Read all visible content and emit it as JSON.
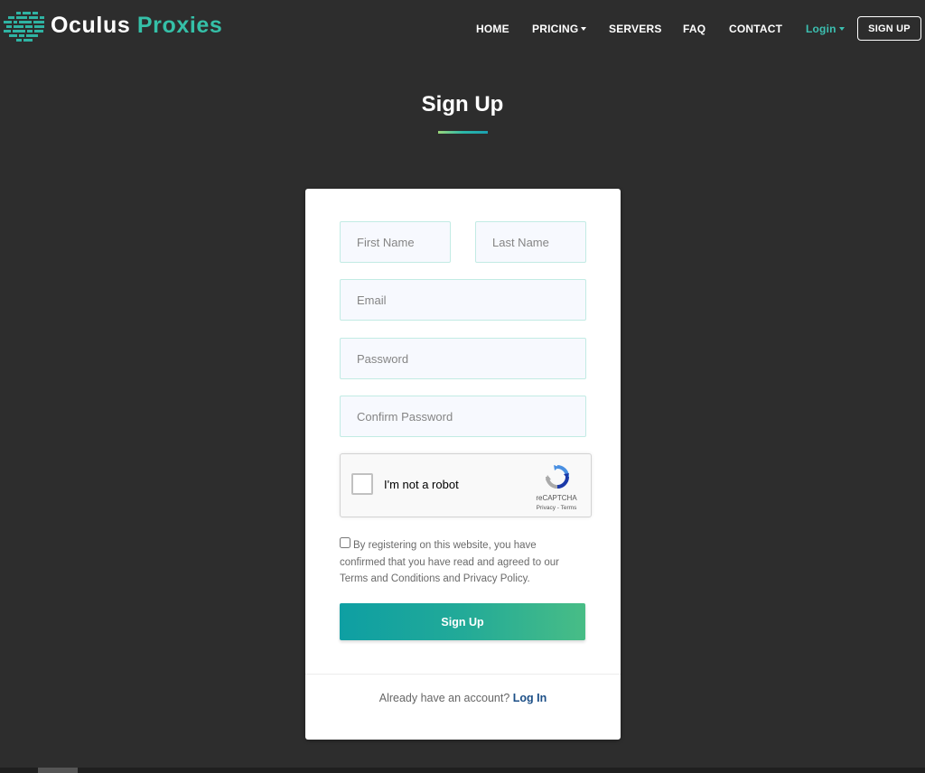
{
  "brand": {
    "name_main": "Oculus",
    "name_accent": "Proxies",
    "accent_color": "#35c0a8"
  },
  "nav": {
    "home": "HOME",
    "pricing": "PRICING",
    "servers": "SERVERS",
    "faq": "FAQ",
    "contact": "CONTACT",
    "login": "Login",
    "signup": "SIGN UP"
  },
  "page": {
    "title": "Sign Up"
  },
  "form": {
    "first_name": {
      "placeholder": "First Name",
      "value": ""
    },
    "last_name": {
      "placeholder": "Last Name",
      "value": ""
    },
    "email": {
      "placeholder": "Email",
      "value": ""
    },
    "password": {
      "placeholder": "Password",
      "value": ""
    },
    "confirm_password": {
      "placeholder": "Confirm Password",
      "value": ""
    },
    "captcha": {
      "label": "I'm not a robot",
      "brand": "reCAPTCHA",
      "privacy": "Privacy",
      "separator": " - ",
      "terms": "Terms",
      "checked": false
    },
    "terms_text": "By registering on this website, you have confirmed that you have read and agreed to our Terms and Conditions and Privacy Policy.",
    "terms_checked": false,
    "submit": "Sign Up"
  },
  "footer": {
    "prompt": "Already have an account?",
    "login_link": "Log In"
  },
  "colors": {
    "background": "#2d2d2d",
    "teal": "#0e9fa3",
    "green": "#48bd86",
    "login_link": "#1c4f87",
    "nav_login": "#3cc0b1"
  },
  "icons": [
    "brand-logo-icon",
    "caret-down-icon",
    "recaptcha-icon"
  ]
}
